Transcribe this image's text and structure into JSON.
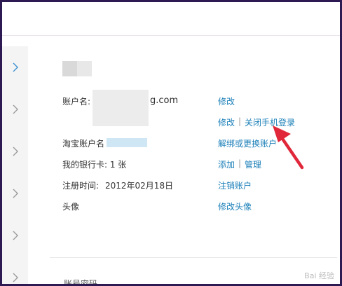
{
  "account": {
    "account_name_label": "账户名:",
    "account_name_value_suffix": "g.com",
    "taobao_label": "淘宝账户名",
    "bank_card_label": "我的银行卡: 1 张",
    "register_label": "注册时间:",
    "register_value": "2012年02月18日",
    "avatar_label": "头像"
  },
  "links": {
    "edit_account": "修改",
    "edit_phone": "修改",
    "separator": "|",
    "close_phone_login": "关闭手机登录",
    "unbind_taobao": "解绑或更换账户",
    "add_bank": "添加",
    "manage_bank": "管理",
    "cancel_account": "注销账户",
    "edit_avatar": "修改头像"
  },
  "bottom": {
    "section_partial": "账号密码",
    "watermark": "Bai 经验"
  },
  "colors": {
    "link": "#1a7fb8",
    "arrow": "#e0283a",
    "frame": "#2e1a52"
  }
}
